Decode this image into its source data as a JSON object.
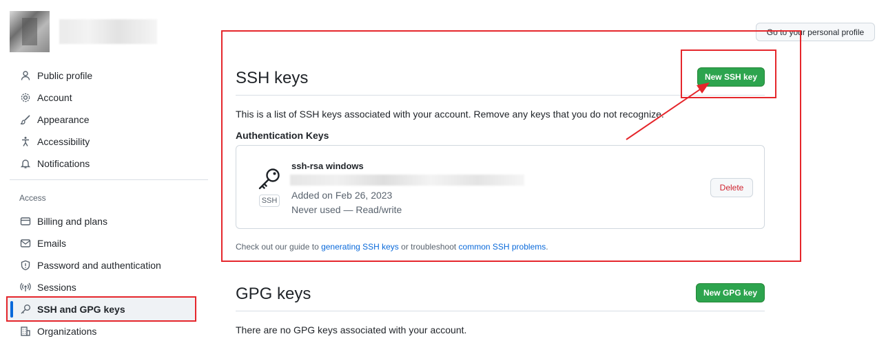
{
  "header": {
    "profile_button": "Go to your personal profile"
  },
  "sidebar": {
    "items": [
      {
        "label": "Public profile",
        "icon": "person-icon"
      },
      {
        "label": "Account",
        "icon": "gear-icon"
      },
      {
        "label": "Appearance",
        "icon": "paintbrush-icon"
      },
      {
        "label": "Accessibility",
        "icon": "accessibility-icon"
      },
      {
        "label": "Notifications",
        "icon": "bell-icon"
      }
    ],
    "access_heading": "Access",
    "access_items": [
      {
        "label": "Billing and plans",
        "icon": "credit-card-icon"
      },
      {
        "label": "Emails",
        "icon": "mail-icon"
      },
      {
        "label": "Password and authentication",
        "icon": "shield-icon"
      },
      {
        "label": "Sessions",
        "icon": "broadcast-icon"
      },
      {
        "label": "SSH and GPG keys",
        "icon": "key-icon",
        "active": true
      },
      {
        "label": "Organizations",
        "icon": "organization-icon"
      }
    ]
  },
  "ssh": {
    "title": "SSH keys",
    "new_button": "New SSH key",
    "description": "This is a list of SSH keys associated with your account. Remove any keys that you do not recognize.",
    "auth_heading": "Authentication Keys",
    "keys": [
      {
        "title": "ssh-rsa windows",
        "badge": "SSH",
        "added": "Added on Feb 26, 2023",
        "usage": "Never used — Read/write",
        "delete_label": "Delete"
      }
    ],
    "footnote": {
      "prefix": "Check out our guide to ",
      "link1": "generating SSH keys",
      "middle": " or troubleshoot ",
      "link2": "common SSH problems",
      "suffix": "."
    }
  },
  "gpg": {
    "title": "GPG keys",
    "new_button": "New GPG key",
    "empty": "There are no GPG keys associated with your account."
  },
  "colors": {
    "accent_green": "#2da44e",
    "annotation_red": "#e5262b",
    "link_blue": "#0969da",
    "danger_red": "#cf222e"
  }
}
